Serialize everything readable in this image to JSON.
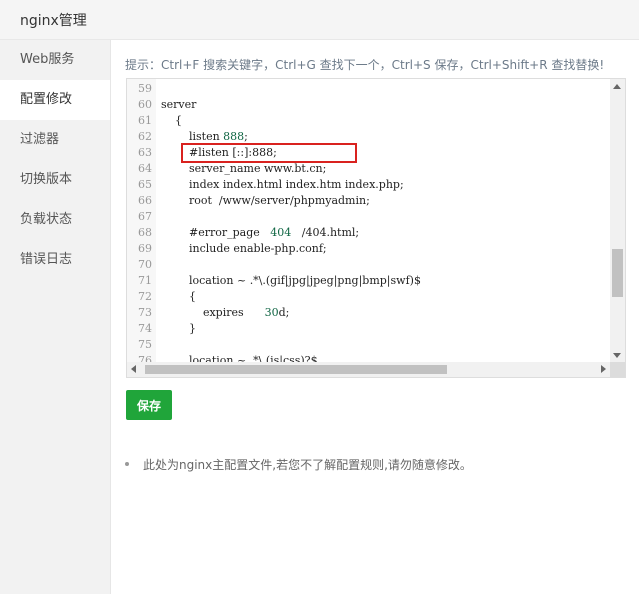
{
  "window": {
    "title": "nginx管理"
  },
  "sidebar": {
    "items": [
      {
        "label": "Web服务"
      },
      {
        "label": "配置修改"
      },
      {
        "label": "过滤器"
      },
      {
        "label": "切换版本"
      },
      {
        "label": "负载状态"
      },
      {
        "label": "错误日志"
      }
    ],
    "active": "配置修改"
  },
  "main": {
    "hint": "提示：Ctrl+F 搜索关键字，Ctrl+G 查找下一个，Ctrl+S 保存，Ctrl+Shift+R 查找替换!",
    "editor": {
      "lines": [
        {
          "num": "59",
          "code": ""
        },
        {
          "num": "60",
          "code": "server"
        },
        {
          "num": "61",
          "code": "    {"
        },
        {
          "num": "62",
          "code": "        listen ",
          "value": "888",
          "suffix": ";"
        },
        {
          "num": "63",
          "code": "        #listen [::]:888;"
        },
        {
          "num": "64",
          "code": "        server_name www.bt.cn;"
        },
        {
          "num": "65",
          "code": "        index index.html index.htm index.php;"
        },
        {
          "num": "66",
          "code": "        root  /www/server/phpmyadmin;"
        },
        {
          "num": "67",
          "code": ""
        },
        {
          "num": "68",
          "code": "        #error_page   ",
          "value": "404",
          "suffix": "   /404.html;"
        },
        {
          "num": "69",
          "code": "        include enable-php.conf;"
        },
        {
          "num": "70",
          "code": ""
        },
        {
          "num": "71",
          "code": "        location ~ .*\\.(gif|jpg|jpeg|png|bmp|swf)$"
        },
        {
          "num": "72",
          "code": "        {"
        },
        {
          "num": "73",
          "code": "            expires      ",
          "value": "30",
          "suffix": "d;"
        },
        {
          "num": "74",
          "code": "        }"
        },
        {
          "num": "75",
          "code": ""
        },
        {
          "num": "76",
          "code": "        location ~ .*\\.(js|css)?$"
        }
      ],
      "highlighted_line": "63"
    },
    "save_label": "保存",
    "notes": [
      "此处为nginx主配置文件,若您不了解配置规则,请勿随意修改。"
    ]
  },
  "colors": {
    "accent": "#20a53a",
    "highlight_border": "#d9221f",
    "number_literal": "#116644"
  }
}
